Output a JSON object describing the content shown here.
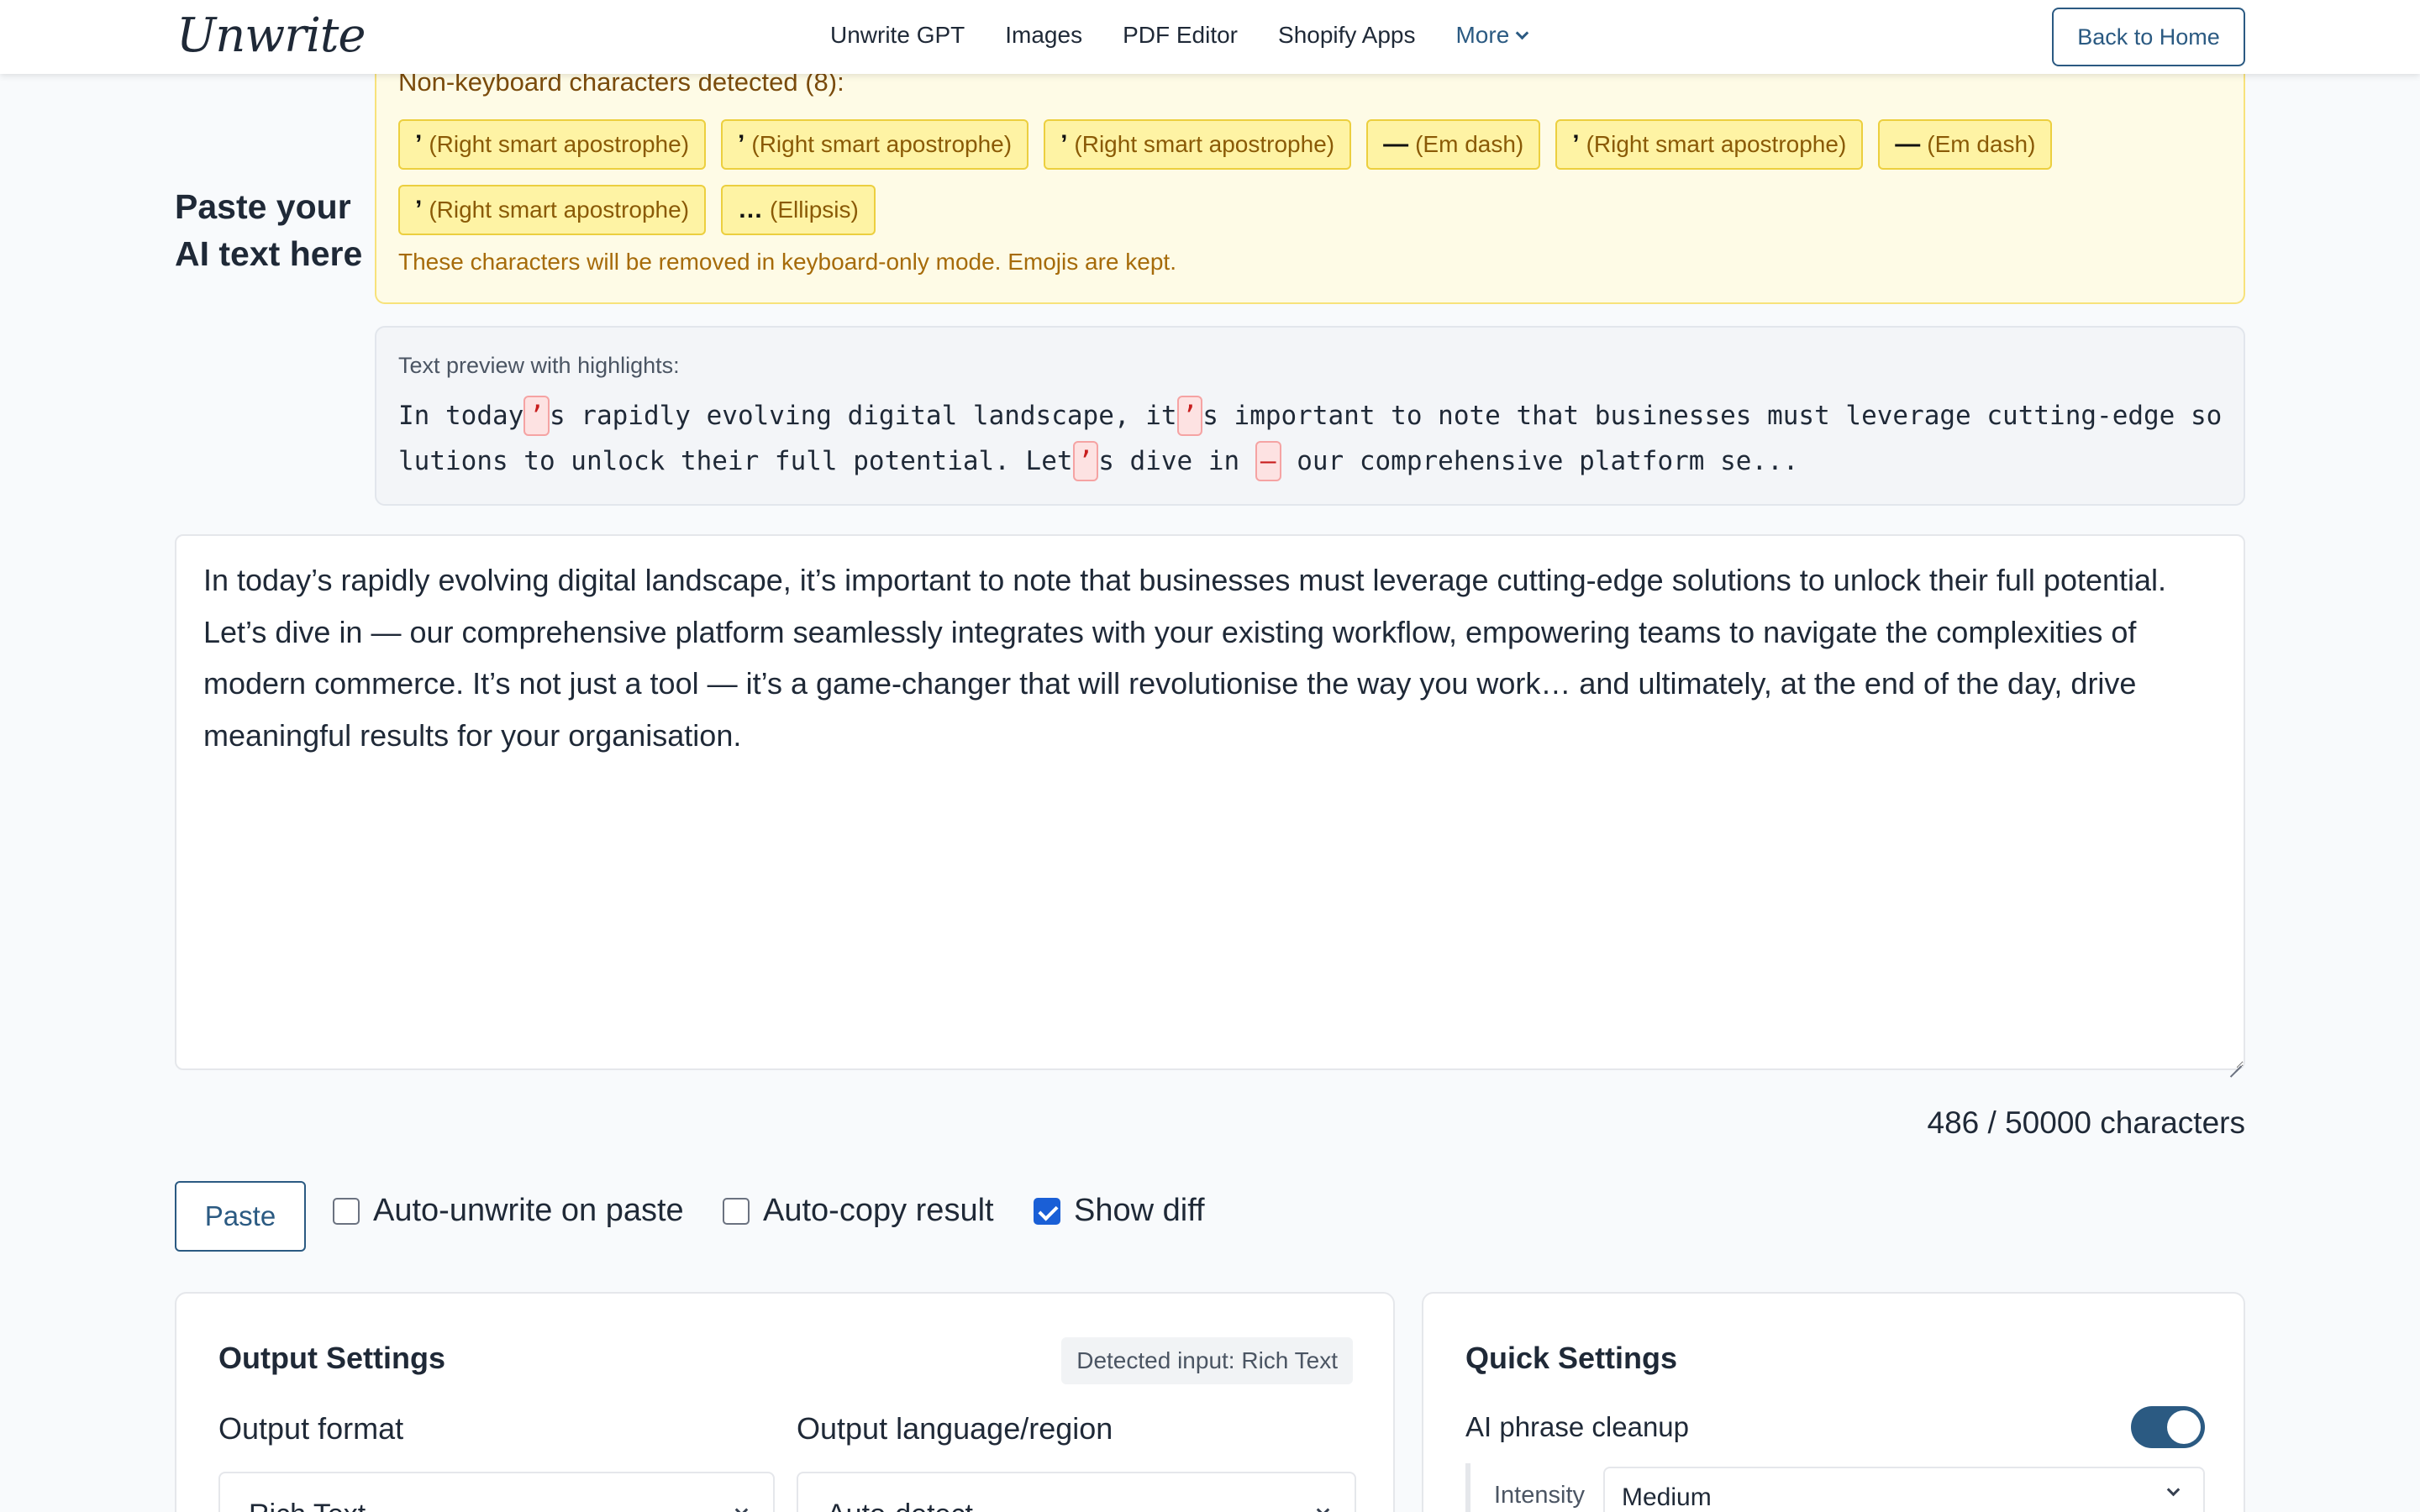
{
  "header": {
    "logo": "Unwrite",
    "nav": [
      "Unwrite GPT",
      "Images",
      "PDF Editor",
      "Shopify Apps"
    ],
    "more_label": "More",
    "back_label": "Back to Home"
  },
  "input_label": [
    "Paste your",
    "AI text here"
  ],
  "warning": {
    "title": "Non-keyboard characters detected (8):",
    "chips": [
      {
        "char": "’",
        "name": "(Right smart apostrophe)"
      },
      {
        "char": "’",
        "name": "(Right smart apostrophe)"
      },
      {
        "char": "’",
        "name": "(Right smart apostrophe)"
      },
      {
        "char": "—",
        "name": "(Em dash)"
      },
      {
        "char": "’",
        "name": "(Right smart apostrophe)"
      },
      {
        "char": "—",
        "name": "(Em dash)"
      },
      {
        "char": "’",
        "name": "(Right smart apostrophe)"
      },
      {
        "char": "…",
        "name": "(Ellipsis)"
      }
    ],
    "note": "These characters will be removed in keyboard-only mode. Emojis are kept."
  },
  "preview": {
    "title": "Text preview with highlights:",
    "segments": [
      {
        "t": "In today"
      },
      {
        "t": "’",
        "hl": true
      },
      {
        "t": "s rapidly evolving digital landscape, it"
      },
      {
        "t": "’",
        "hl": true
      },
      {
        "t": "s important to note that businesses must leverage cutting-edge solutions to unlock their full potential. Let"
      },
      {
        "t": "’",
        "hl": true
      },
      {
        "t": "s dive in "
      },
      {
        "t": "—",
        "hl": true
      },
      {
        "t": " our comprehensive platform se..."
      }
    ]
  },
  "editor": {
    "text": "In today’s rapidly evolving digital landscape, it’s important to note that businesses must leverage cutting-edge solutions to unlock their full potential. Let’s dive in — our comprehensive platform seamlessly integrates with your existing workflow, empowering teams to navigate the complexities of modern commerce. It’s not just a tool — it’s a game-changer that will revolutionise the way you work… and ultimately, at the end of the day, drive meaningful results for your organisation."
  },
  "char_count": "486 / 50000 characters",
  "controls": {
    "paste_label": "Paste",
    "auto_unwrite": {
      "label": "Auto-unwrite on paste",
      "checked": false
    },
    "auto_copy": {
      "label": "Auto-copy result",
      "checked": false
    },
    "show_diff": {
      "label": "Show diff",
      "checked": true
    }
  },
  "output_settings": {
    "title": "Output Settings",
    "detected": "Detected input: Rich Text",
    "format_label": "Output format",
    "format_value": "Rich Text",
    "language_label": "Output language/region",
    "language_value": "Auto-detect"
  },
  "quick_settings": {
    "title": "Quick Settings",
    "cleanup_label": "AI phrase cleanup",
    "cleanup_on": true,
    "intensity_label": "Intensity",
    "intensity_value": "Medium"
  },
  "colors": {
    "accent": "#2b5a82",
    "checkbox": "#1a5fd6",
    "warning_bg": "#fefbe6",
    "highlight": "#fde2e2"
  }
}
